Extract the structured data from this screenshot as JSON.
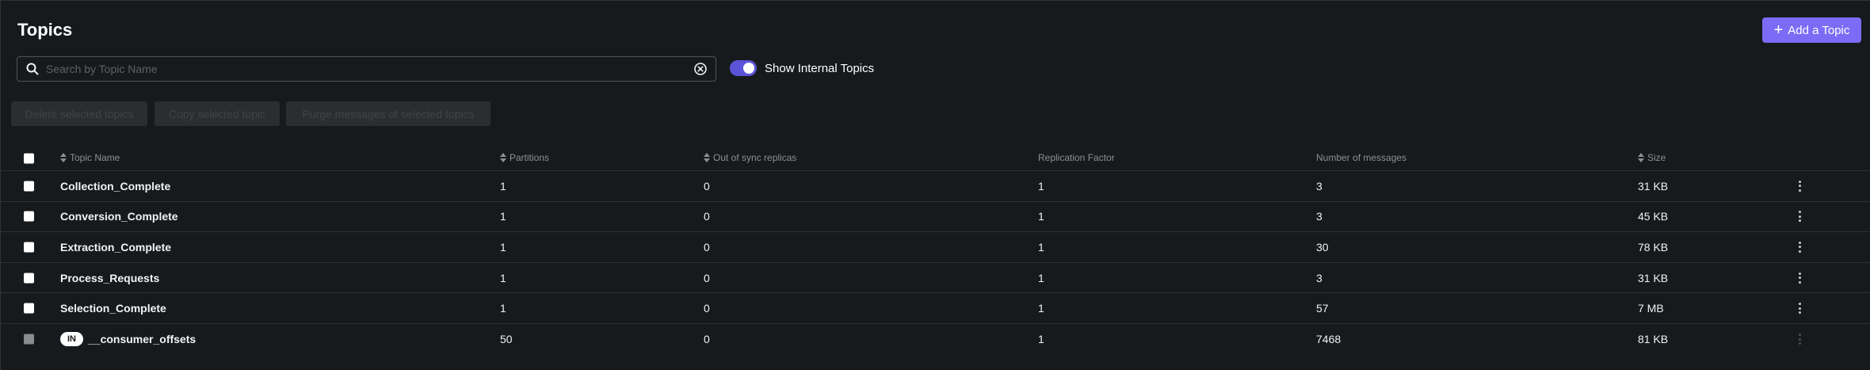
{
  "header": {
    "title": "Topics",
    "add_button_label": "Add a Topic"
  },
  "search": {
    "placeholder": "Search by Topic Name",
    "value": ""
  },
  "toggle": {
    "label": "Show Internal Topics",
    "enabled": true
  },
  "bulk_actions": [
    {
      "label": "Delete selected topics"
    },
    {
      "label": "Copy selected topic"
    },
    {
      "label": "Purge messages of selected topics"
    }
  ],
  "table": {
    "columns": [
      {
        "label": "Topic Name",
        "sortable": true
      },
      {
        "label": "Partitions",
        "sortable": true
      },
      {
        "label": "Out of sync replicas",
        "sortable": true
      },
      {
        "label": "Replication Factor",
        "sortable": false
      },
      {
        "label": "Number of messages",
        "sortable": false
      },
      {
        "label": "Size",
        "sortable": true
      }
    ],
    "rows": [
      {
        "name": "Collection_Complete",
        "partitions": "1",
        "out_of_sync": "0",
        "replication": "1",
        "messages": "3",
        "size": "31 KB"
      },
      {
        "name": "Conversion_Complete",
        "partitions": "1",
        "out_of_sync": "0",
        "replication": "1",
        "messages": "3",
        "size": "45 KB"
      },
      {
        "name": "Extraction_Complete",
        "partitions": "1",
        "out_of_sync": "0",
        "replication": "1",
        "messages": "30",
        "size": "78 KB"
      },
      {
        "name": "Process_Requests",
        "partitions": "1",
        "out_of_sync": "0",
        "replication": "1",
        "messages": "3",
        "size": "31 KB"
      },
      {
        "name": "Selection_Complete",
        "partitions": "1",
        "out_of_sync": "0",
        "replication": "1",
        "messages": "57",
        "size": "7 MB"
      },
      {
        "name": "__consumer_offsets",
        "badge": "IN",
        "partitions": "50",
        "out_of_sync": "0",
        "replication": "1",
        "messages": "7468",
        "size": "81 KB"
      }
    ]
  },
  "colors": {
    "accent": "#7b6cf6",
    "toggle_on": "#5b54d8",
    "background": "#171a1c"
  },
  "icons": {
    "search": "search-icon",
    "clear": "clear-icon",
    "add": "plus-icon",
    "menu": "kebab-icon",
    "sort": "sort-icon"
  }
}
